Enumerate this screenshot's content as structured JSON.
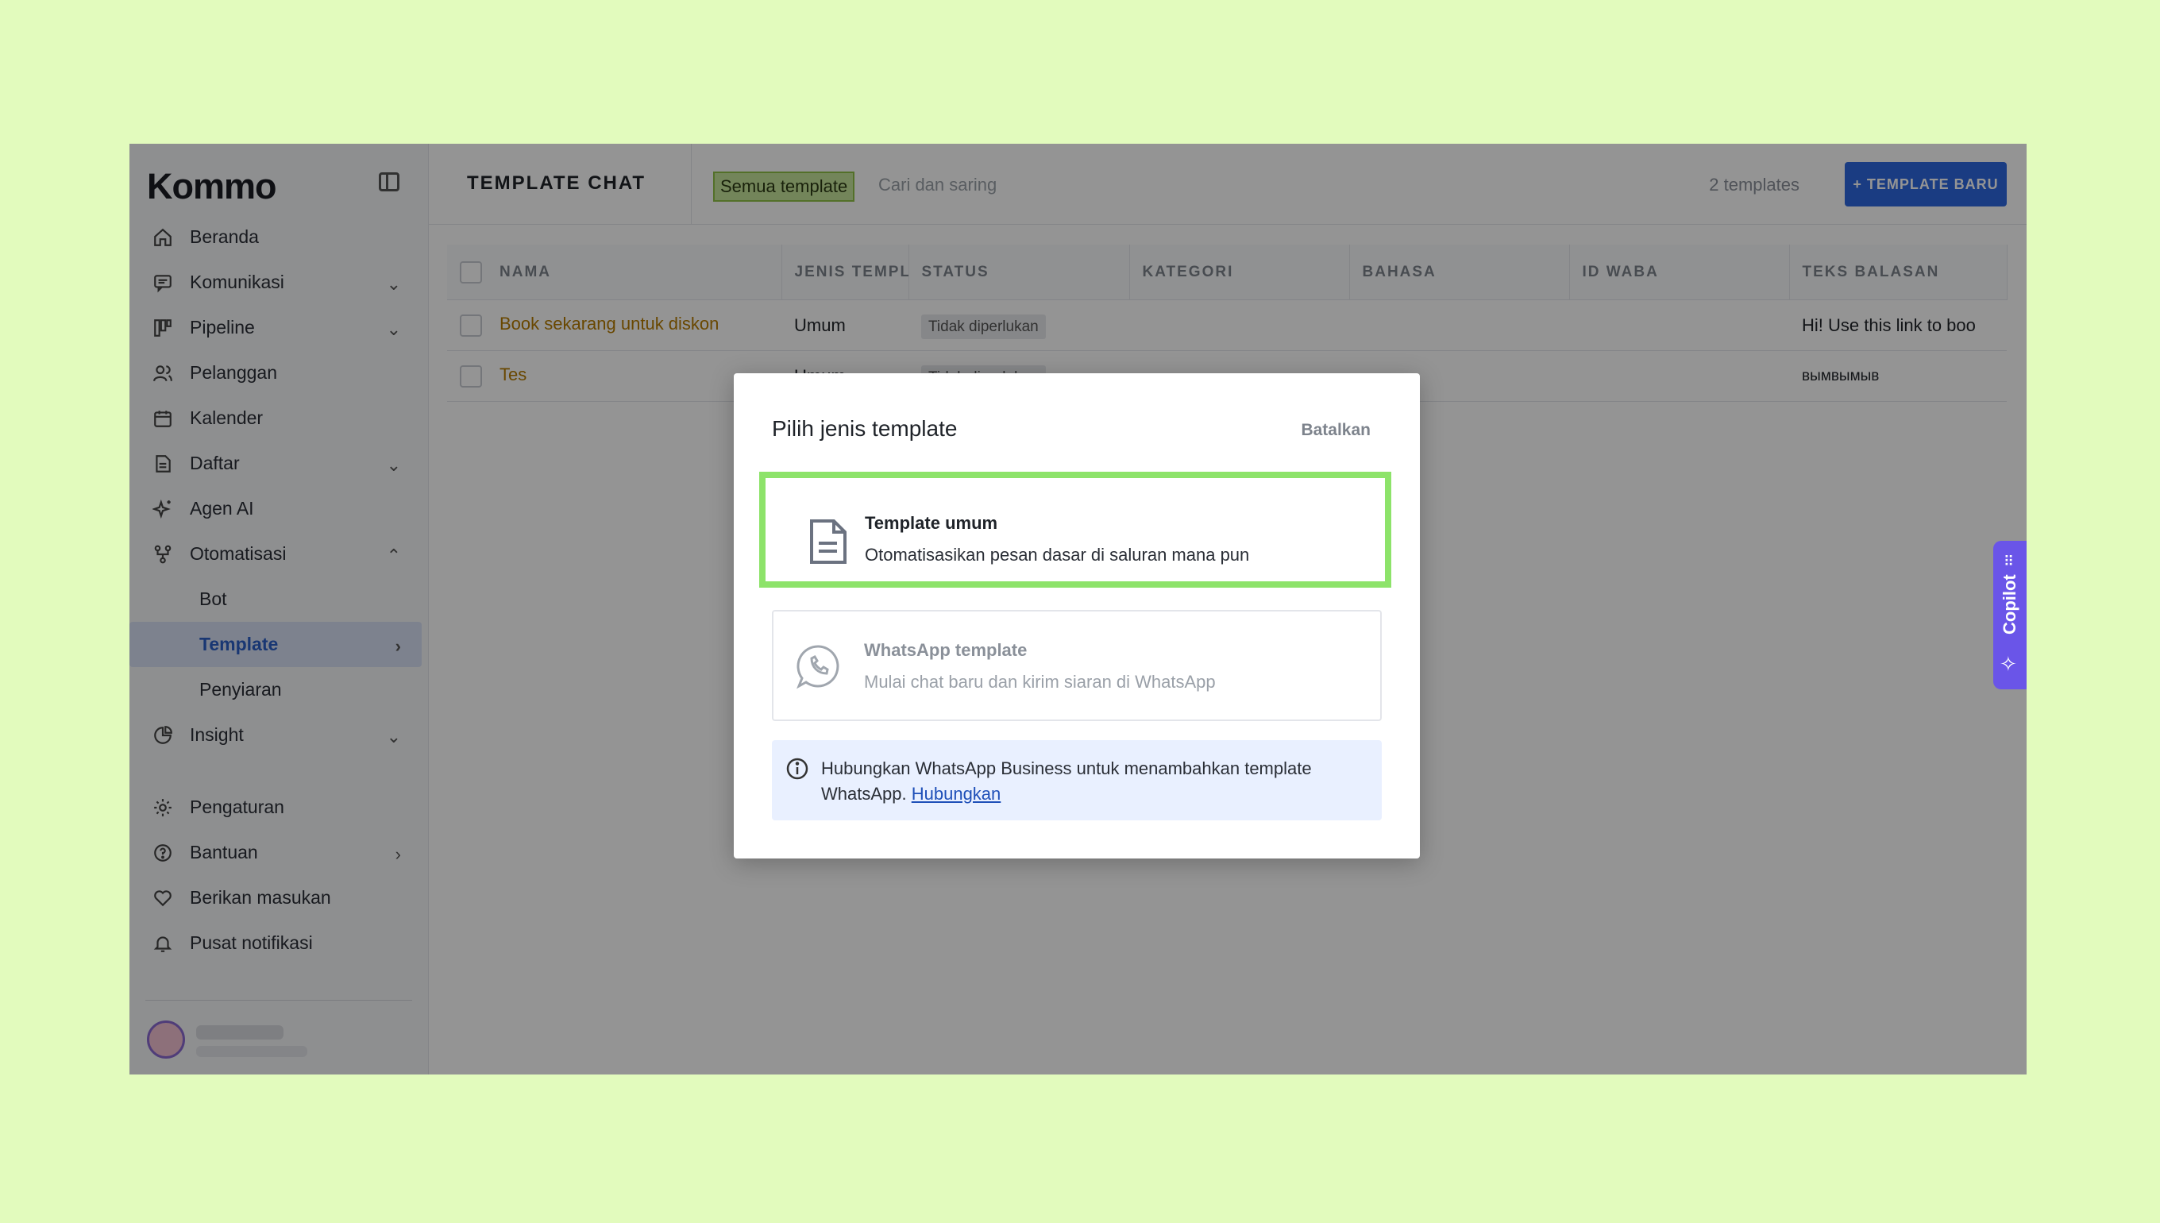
{
  "app": {
    "logo": "Kommo"
  },
  "sidebar": {
    "items": [
      {
        "label": "Beranda",
        "icon": "home-icon",
        "chevron": ""
      },
      {
        "label": "Komunikasi",
        "icon": "chat-icon",
        "chevron": "⌄"
      },
      {
        "label": "Pipeline",
        "icon": "pipeline-icon",
        "chevron": "⌄"
      },
      {
        "label": "Pelanggan",
        "icon": "users-icon",
        "chevron": ""
      },
      {
        "label": "Kalender",
        "icon": "calendar-icon",
        "chevron": ""
      },
      {
        "label": "Daftar",
        "icon": "list-icon",
        "chevron": "⌄"
      },
      {
        "label": "Agen AI",
        "icon": "sparkle-icon",
        "chevron": ""
      },
      {
        "label": "Otomatisasi",
        "icon": "automation-icon",
        "chevron": "⌃"
      }
    ],
    "subitems": [
      {
        "label": "Bot"
      },
      {
        "label": "Template",
        "chevron": "›"
      },
      {
        "label": "Penyiaran"
      }
    ],
    "insight": {
      "label": "Insight",
      "chevron": "⌄"
    },
    "bottom_items": [
      {
        "label": "Pengaturan",
        "icon": "gear-icon",
        "chevron": ""
      },
      {
        "label": "Bantuan",
        "icon": "help-icon",
        "chevron": "›"
      },
      {
        "label": "Berikan masukan",
        "icon": "heart-icon",
        "chevron": ""
      },
      {
        "label": "Pusat notifikasi",
        "icon": "bell-icon",
        "chevron": ""
      }
    ]
  },
  "header": {
    "title": "TEMPLATE CHAT",
    "filter_chip": "Semua template",
    "search_placeholder": "Cari dan saring",
    "count": "2 templates",
    "new_button": "+ TEMPLATE BARU"
  },
  "table": {
    "columns": [
      "NAMA",
      "JENIS TEMPLATE",
      "STATUS",
      "KATEGORI",
      "BAHASA",
      "ID WABA",
      "TEKS BALASAN"
    ],
    "rows": [
      {
        "name": "Book sekarang untuk diskon",
        "type": "Umum",
        "status": "Tidak diperlukan",
        "category": "",
        "language": "",
        "waba": "",
        "reply": "Hi! Use this link to boo"
      },
      {
        "name": "Tes",
        "type": "Umum",
        "status": "Tidak diperlukan",
        "category": "",
        "language": "",
        "waba": "",
        "reply": "вымвымыв"
      }
    ]
  },
  "copilot": {
    "label": "Copilot"
  },
  "modal": {
    "title": "Pilih jenis template",
    "cancel": "Batalkan",
    "general": {
      "title": "Template umum",
      "desc": "Otomatisasikan pesan dasar di saluran mana pun",
      "icon": "document-icon"
    },
    "whatsapp": {
      "title": "WhatsApp template",
      "desc": "Mulai chat baru dan kirim siaran di WhatsApp",
      "icon": "whatsapp-icon"
    },
    "info": {
      "text": "Hubungkan WhatsApp Business untuk menambahkan template WhatsApp.",
      "link": "Hubungkan"
    }
  },
  "colors": {
    "accent": "#2d68e0",
    "highlight": "#8de36a",
    "background": "#e2fbbd"
  }
}
